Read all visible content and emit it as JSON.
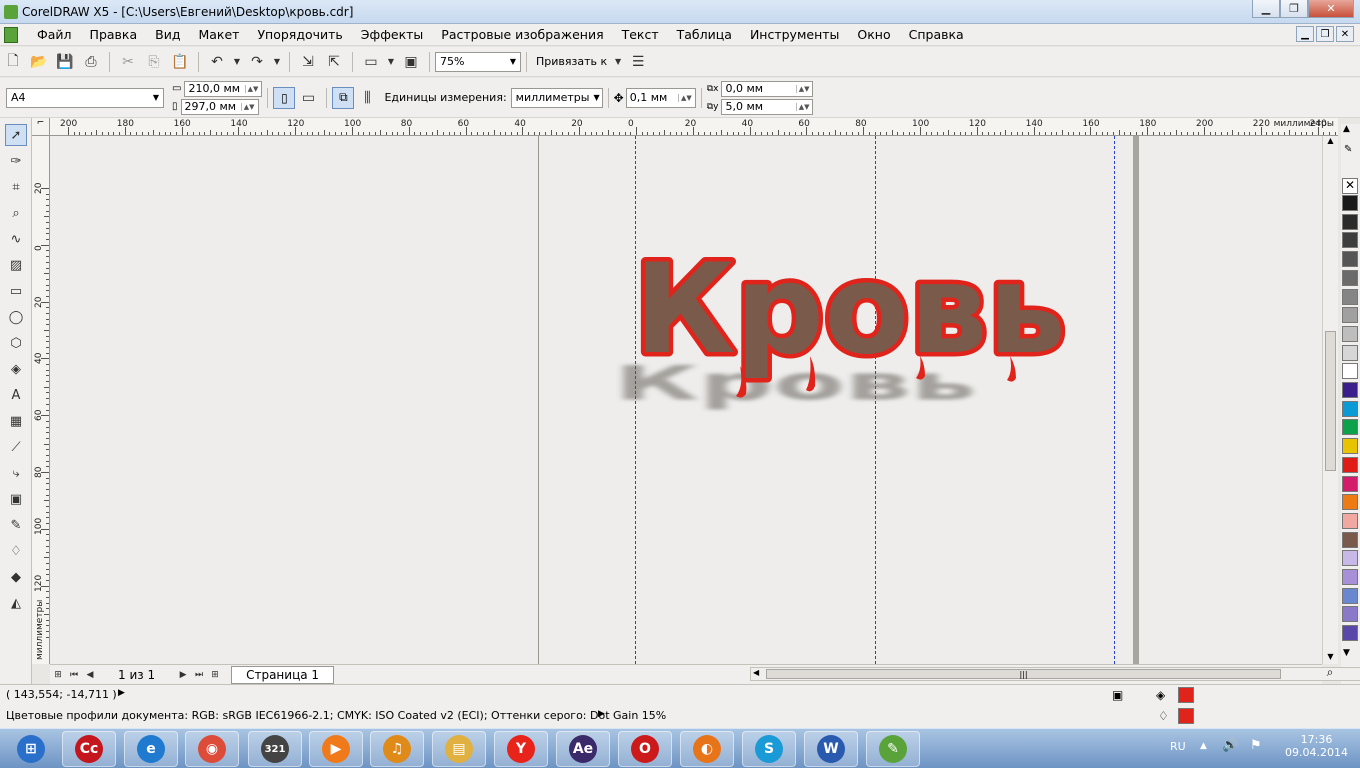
{
  "window": {
    "title": "CorelDRAW X5 - [C:\\Users\\Евгений\\Desktop\\кровь.cdr]"
  },
  "menu": [
    "Файл",
    "Правка",
    "Вид",
    "Макет",
    "Упорядочить",
    "Эффекты",
    "Растровые изображения",
    "Текст",
    "Таблица",
    "Инструменты",
    "Окно",
    "Справка"
  ],
  "standard_toolbar": {
    "zoom": "75%",
    "snap_label": "Привязать к"
  },
  "property_bar": {
    "paper_size": "A4",
    "width": "210,0 мм",
    "height": "297,0 мм",
    "units_label": "Единицы измерения:",
    "units_value": "миллиметры",
    "nudge": "0,1 мм",
    "dup_x": "0,0 мм",
    "dup_y": "5,0 мм"
  },
  "ruler": {
    "units": "миллиметры",
    "h_labels": [
      "200",
      "180",
      "160",
      "140",
      "120",
      "100",
      "80",
      "60",
      "40",
      "20",
      "0",
      "20",
      "40",
      "60",
      "80",
      "100",
      "120",
      "140",
      "160",
      "180",
      "200",
      "220",
      "240"
    ],
    "v_labels": [
      "20",
      "0",
      "20",
      "40",
      "60",
      "80",
      "100",
      "120"
    ]
  },
  "artwork": {
    "text": "Кровь",
    "fill_color": "#7a5a4a",
    "outline_color": "#e0241c"
  },
  "pagenav": {
    "counter": "1 из 1",
    "tab": "Страница 1"
  },
  "status": {
    "coords": "( 143,554; -14,711 )",
    "color_profiles": "Цветовые профили документа: RGB: sRGB IEC61966-2.1; CMYK: ISO Coated v2 (ECI); Оттенки серого: Dot Gain 15%",
    "fill_color": "#e0241c",
    "outline_color": "#e0241c"
  },
  "palette": [
    "#1a1a1a",
    "#2b2b2b",
    "#3d3d3d",
    "#555555",
    "#6b6b6b",
    "#858585",
    "#a0a0a0",
    "#bdbdbd",
    "#d6d6d6",
    "#ffffff",
    "#3a1f8c",
    "#0a9ad6",
    "#0ca24a",
    "#e8c400",
    "#e01a14",
    "#d41a6a",
    "#ee7a14",
    "#f0a8a0",
    "#7a5a4a",
    "#c8b8e8",
    "#a890d8",
    "#6a88d0",
    "#8a78c8",
    "#5a48a8"
  ],
  "taskbar": {
    "lang": "RU",
    "time": "17:36",
    "date": "09.04.2014",
    "apps": [
      {
        "name": "start-button",
        "glyph": "⊞",
        "color": "#2a6fc9"
      },
      {
        "name": "adobe-cc-app",
        "glyph": "Cc",
        "color": "#c4161c"
      },
      {
        "name": "internet-explorer-app",
        "glyph": "e",
        "color": "#1f7ad0"
      },
      {
        "name": "chrome-app",
        "glyph": "◉",
        "color": "#dd4b39"
      },
      {
        "name": "media-player-classic-app",
        "glyph": "321",
        "color": "#444444"
      },
      {
        "name": "media-player-app",
        "glyph": "▶",
        "color": "#f07a1a"
      },
      {
        "name": "audio-app",
        "glyph": "♫",
        "color": "#e08a1a"
      },
      {
        "name": "explorer-app",
        "glyph": "▤",
        "color": "#e0b040"
      },
      {
        "name": "yandex-browser-app",
        "glyph": "Y",
        "color": "#e8231a"
      },
      {
        "name": "after-effects-app",
        "glyph": "Ae",
        "color": "#3a2a6a"
      },
      {
        "name": "opera-app",
        "glyph": "O",
        "color": "#cc1a1a"
      },
      {
        "name": "firefox-app",
        "glyph": "◐",
        "color": "#e8741a"
      },
      {
        "name": "skype-app",
        "glyph": "S",
        "color": "#1a9ad6"
      },
      {
        "name": "word-app",
        "glyph": "W",
        "color": "#2a5ab0"
      },
      {
        "name": "coreldraw-app",
        "glyph": "✎",
        "color": "#5aa33a"
      }
    ]
  }
}
